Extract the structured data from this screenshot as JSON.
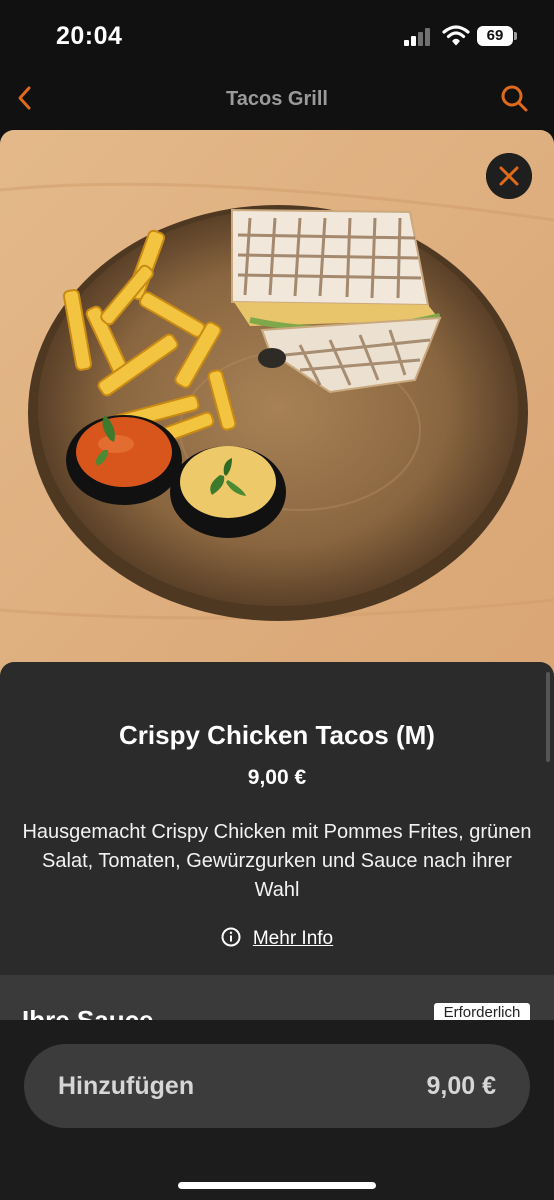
{
  "status_bar": {
    "time": "20:04",
    "battery_level": "69",
    "icons": [
      "signal-icon",
      "wifi-icon",
      "battery-icon"
    ]
  },
  "nav": {
    "title": "Tacos Grill",
    "back_icon": "chevron-left-icon",
    "search_icon": "search-icon"
  },
  "hero": {
    "close_icon": "close-icon"
  },
  "item": {
    "title": "Crispy Chicken Tacos (M)",
    "price": "9,00 €",
    "description": "Hausgemacht Crispy Chicken mit Pommes Frites, grünen Salat, Tomaten, Gewürzgurken und Sauce nach ihrer Wahl",
    "more_info_label": "Mehr Info"
  },
  "options_section": {
    "title": "Ihre Sauce",
    "required_label": "Erforderlich"
  },
  "footer": {
    "add_label": "Hinzufügen",
    "total_price": "9,00 €"
  },
  "colors": {
    "accent": "#e06a1b",
    "background": "#111111",
    "sheet": "#2b2b2b"
  }
}
